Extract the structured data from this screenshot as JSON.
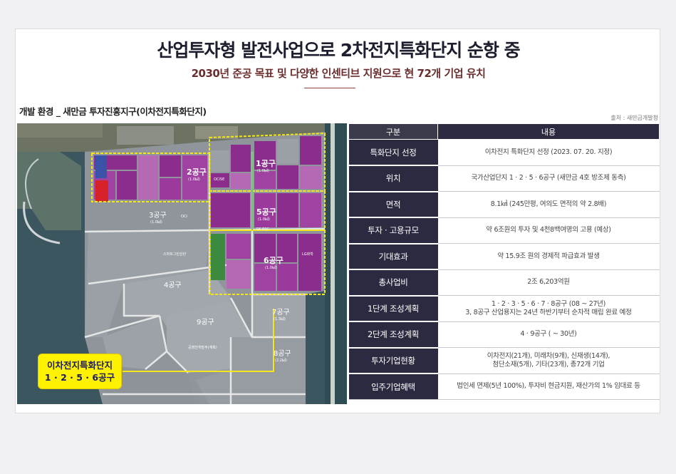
{
  "header": {
    "title": "산업투자형 발전사업으로 2차전지특화단지 순항 중",
    "subtitle": "2030년 준공 목표 및 다양한 인센티브 지원으로 현 72개 기업 유치"
  },
  "section": {
    "title": "개발 환경 _ 새만금 투자진흥지구(이차전지특화단지)",
    "source": "출처 : 새만금개발청"
  },
  "map": {
    "callout_line1": "이차전지특화단지",
    "callout_line2": "1 · 2 · 5 · 6공구",
    "zone_labels": {
      "z1": "1공구",
      "z1_area": "(1.0㎢)",
      "z2": "2공구",
      "z2_area": "(1.0㎢)",
      "z3": "3공구",
      "z3_area": "(1.0㎢)",
      "z4": "4공구",
      "z5": "5공구",
      "z5_area": "(1.0㎢)",
      "z6": "6공구",
      "z6_area": "(1.0㎢)",
      "z7": "7공구",
      "z7_area": "(1.3㎢)",
      "z8": "8공구",
      "z8_area": "(2.2㎢)",
      "z9": "9공구"
    },
    "place_labels": {
      "ocise": "OCISE",
      "oci": "OCI",
      "lg": "LG화학",
      "sk": "SK ESC",
      "smartgreen": "스마트그린산단",
      "gongyeong": "공영전개발주(계획)"
    },
    "colors": {
      "occupied": "#8b2d8c",
      "occupied_light": "#b568b3",
      "unoccupied": "#9aa0a6",
      "road": "#e6e6e6",
      "boundary": "#f5e61a",
      "water": "#3c5862"
    }
  },
  "table": {
    "headers": [
      "구분",
      "내용"
    ],
    "rows": [
      {
        "key": "특화단지 선정",
        "value": [
          "이차전지 특화단지 선정 (2023. 07. 20. 지정)"
        ]
      },
      {
        "key": "위치",
        "value": [
          "국가산업단지 1 · 2 · 5 · 6공구 (새만금 4호 방조제 동측)"
        ]
      },
      {
        "key": "면적",
        "value": [
          "8.1㎢ (245만평, 여의도 면적의 약 2.8배)"
        ]
      },
      {
        "key": "투자 · 고용규모",
        "value": [
          "약 6조원의 투자 및 4천8백여명의 고용 (예상)"
        ]
      },
      {
        "key": "기대효과",
        "value": [
          "약 15.9조 원의 경제적 파급효과 발생"
        ]
      },
      {
        "key": "총사업비",
        "value": [
          "2조 6,203억원"
        ]
      },
      {
        "key": "1단계 조성계획",
        "value": [
          "1 · 2 · 3 · 5 · 6 · 7 · 8공구 (08 ~ 27년)",
          "3, 8공구 산업용지는 24년 하반기부터 순차적 매립 완료 예정"
        ]
      },
      {
        "key": "2단계 조성계획",
        "value": [
          "4 · 9공구 ( ~ 30년)"
        ]
      },
      {
        "key": "투자기업현황",
        "value": [
          "이차전지(21개), 미래차(9개), 신재생(14개),",
          "첨단소재(5개), 기타(23개), 총72개 기업"
        ]
      },
      {
        "key": "입주기업혜택",
        "value": [
          "법인세 면제(5년 100%), 투자비 현금지원, 재산가의 1% 임대료 등"
        ]
      }
    ]
  }
}
